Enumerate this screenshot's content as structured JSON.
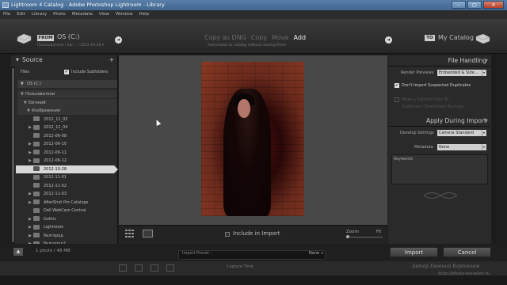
{
  "window": {
    "title": "Lightroom 4 Catalog - Adobe Photoshop Lightroom - Library",
    "minimize": "–",
    "maximize": "□",
    "close": "✕"
  },
  "menu": [
    "File",
    "Edit",
    "Library",
    "Photo",
    "Metadata",
    "View",
    "Window",
    "Help"
  ],
  "header": {
    "from_badge": "FROM",
    "source": "OS (C:)",
    "source_path": "Пользователи \\ Евг... \\ 2012-10-28 ▾",
    "modes": [
      "Copy as DNG",
      "Copy",
      "Move",
      "Add"
    ],
    "active_mode": "Add",
    "mode_subtitle": "Add photos to catalog without moving them",
    "to_badge": "TO",
    "destination": "My Catalog"
  },
  "source_panel": {
    "title": "Source",
    "plus": "+",
    "files_label": "Files",
    "include_subfolders": "Include Subfolders",
    "drive": "OS (C:)",
    "tree": [
      {
        "label": "Пользователи",
        "level": 0,
        "expand": "▼",
        "folder": false
      },
      {
        "label": "Евгений",
        "level": 1,
        "expand": "▼",
        "folder": false
      },
      {
        "label": "Изображения",
        "level": 2,
        "expand": "▼",
        "folder": false
      },
      {
        "label": "2012_11_03",
        "level": 3,
        "expand": "",
        "folder": true
      },
      {
        "label": "2012_11_04",
        "level": 3,
        "expand": "▶",
        "folder": true
      },
      {
        "label": "2012-06-08",
        "level": 3,
        "expand": "",
        "folder": true
      },
      {
        "label": "2012-06-10",
        "level": 3,
        "expand": "▶",
        "folder": true
      },
      {
        "label": "2012-06-11",
        "level": 3,
        "expand": "▶",
        "folder": true
      },
      {
        "label": "2012-06-12",
        "level": 3,
        "expand": "▶",
        "folder": true
      },
      {
        "label": "2012-10-28",
        "level": 3,
        "expand": "",
        "folder": true,
        "selected": true
      },
      {
        "label": "2012-11-01",
        "level": 3,
        "expand": "",
        "folder": true
      },
      {
        "label": "2012-11-02",
        "level": 3,
        "expand": "",
        "folder": true
      },
      {
        "label": "2012-11-03",
        "level": 3,
        "expand": "▶",
        "folder": true
      },
      {
        "label": "AfterShot Pro Catalogs",
        "level": 3,
        "expand": "▶",
        "folder": true
      },
      {
        "label": "Dell WebCam Central",
        "level": 3,
        "expand": "",
        "folder": true
      },
      {
        "label": "Gothic",
        "level": 3,
        "expand": "▶",
        "folder": true
      },
      {
        "label": "Lightroom",
        "level": 3,
        "expand": "▶",
        "folder": true
      },
      {
        "label": "белгород",
        "level": 3,
        "expand": "▶",
        "folder": true
      },
      {
        "label": "белгород2",
        "level": 3,
        "expand": "▶",
        "folder": true
      }
    ]
  },
  "center": {
    "include_in_import": "Include in Import",
    "zoom": "Zoom",
    "fit": "Fit"
  },
  "file_handling": {
    "title": "File Handling",
    "render_previews_label": "Render Previews",
    "render_previews_value": "Embedded & Side...",
    "dont_import_duplicates": "Don't Import Suspected Duplicates",
    "second_copy_label": "Make a Second Copy To :",
    "second_copy_path": "/Lightroom Downloads Backups"
  },
  "apply_during_import": {
    "title": "Apply During Import",
    "develop_settings_label": "Develop Settings",
    "develop_settings_value": "Camera Standard",
    "metadata_label": "Metadata",
    "metadata_value": "None",
    "keywords_label": "Keywords"
  },
  "bottom": {
    "photo_count": "1 photo / 48 MB",
    "import_preset_label": "Import Preset :",
    "import_preset_value": "None ÷",
    "import_button": "Import",
    "cancel_button": "Cancel",
    "filmstrip_text": "Capture Time"
  },
  "watermark": {
    "line1": "Автор Евгений Карташов",
    "line2": "http://photo-monster.ru"
  }
}
